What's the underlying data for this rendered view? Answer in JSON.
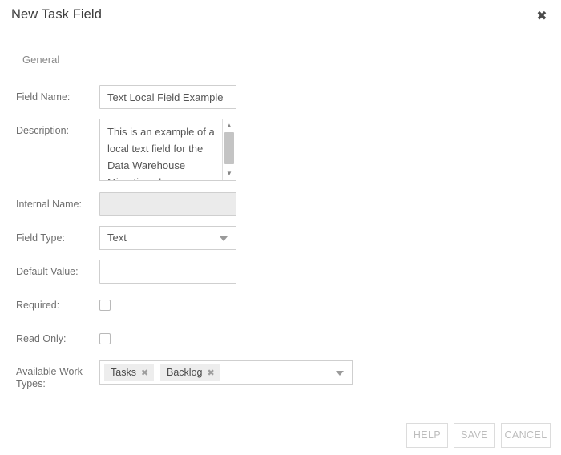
{
  "dialog": {
    "title": "New Task Field",
    "close_icon": "close-icon",
    "section_title": "General"
  },
  "form": {
    "field_name": {
      "label": "Field Name:",
      "value": "Text Local Field Example",
      "placeholder": ""
    },
    "description": {
      "label": "Description:",
      "value": "This is an example of a local text field for the Data Warehouse Migration plan.",
      "scrollbar": {
        "up_icon": "chevron-up-icon",
        "down_icon": "chevron-down-icon"
      }
    },
    "internal_name": {
      "label": "Internal Name:",
      "value": "",
      "placeholder": "",
      "disabled": true
    },
    "field_type": {
      "label": "Field Type:",
      "value": "Text",
      "caret_icon": "chevron-down-icon"
    },
    "default_value": {
      "label": "Default Value:",
      "value": "",
      "placeholder": ""
    },
    "required": {
      "label": "Required:",
      "checked": false
    },
    "read_only": {
      "label": "Read Only:",
      "checked": false
    },
    "available_work_types": {
      "label": "Available Work Types:",
      "tags": [
        {
          "label": "Tasks",
          "remove_icon": "close-icon"
        },
        {
          "label": "Backlog",
          "remove_icon": "close-icon"
        }
      ],
      "caret_icon": "chevron-down-icon"
    }
  },
  "footer": {
    "help_label": "HELP",
    "save_label": "SAVE",
    "cancel_label": "CANCEL"
  },
  "colors": {
    "background": "#ffffff",
    "title_text": "#3c3c3c",
    "label_text": "#6f6f6f",
    "input_border": "#cfcfcf",
    "disabled_bg": "#ebebeb",
    "tag_bg": "#ededed",
    "button_text": "#bdbdbd"
  }
}
